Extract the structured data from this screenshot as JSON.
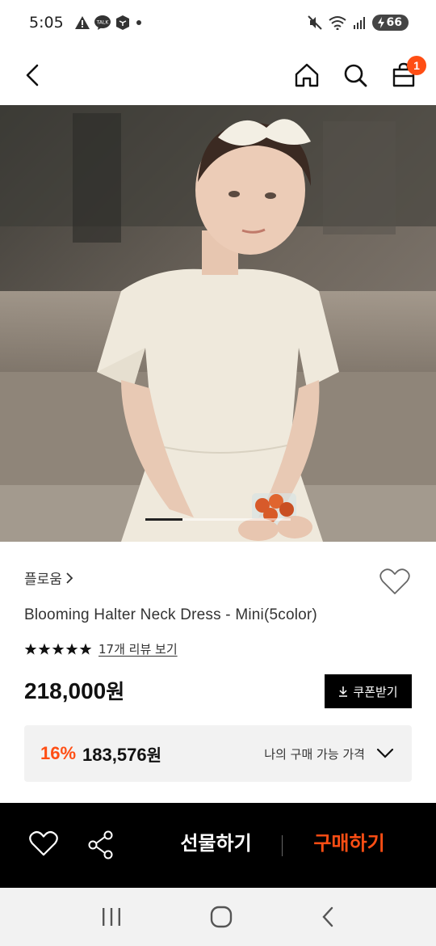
{
  "status_bar": {
    "time": "5:05",
    "battery": "66"
  },
  "header": {
    "cart_count": "1"
  },
  "gallery": {
    "image_description": "product-photo",
    "slide_position": 0.25
  },
  "product": {
    "brand": "플로움",
    "name": "Blooming Halter Neck Dress - Mini(5color)",
    "rating": 5,
    "review_link": "17개 리뷰 보기",
    "price": "218,000",
    "currency": "원",
    "coupon_button": "쿠폰받기",
    "discount_rate": "16%",
    "discounted_price": "183,576",
    "my_price_label": "나의 구매 가능 가격"
  },
  "bottom_bar": {
    "gift_label": "선물하기",
    "buy_label": "구매하기"
  },
  "colors": {
    "accent": "#ff4e14",
    "bottom_bar": "#000000",
    "discount_bg": "#f2f2f2"
  }
}
